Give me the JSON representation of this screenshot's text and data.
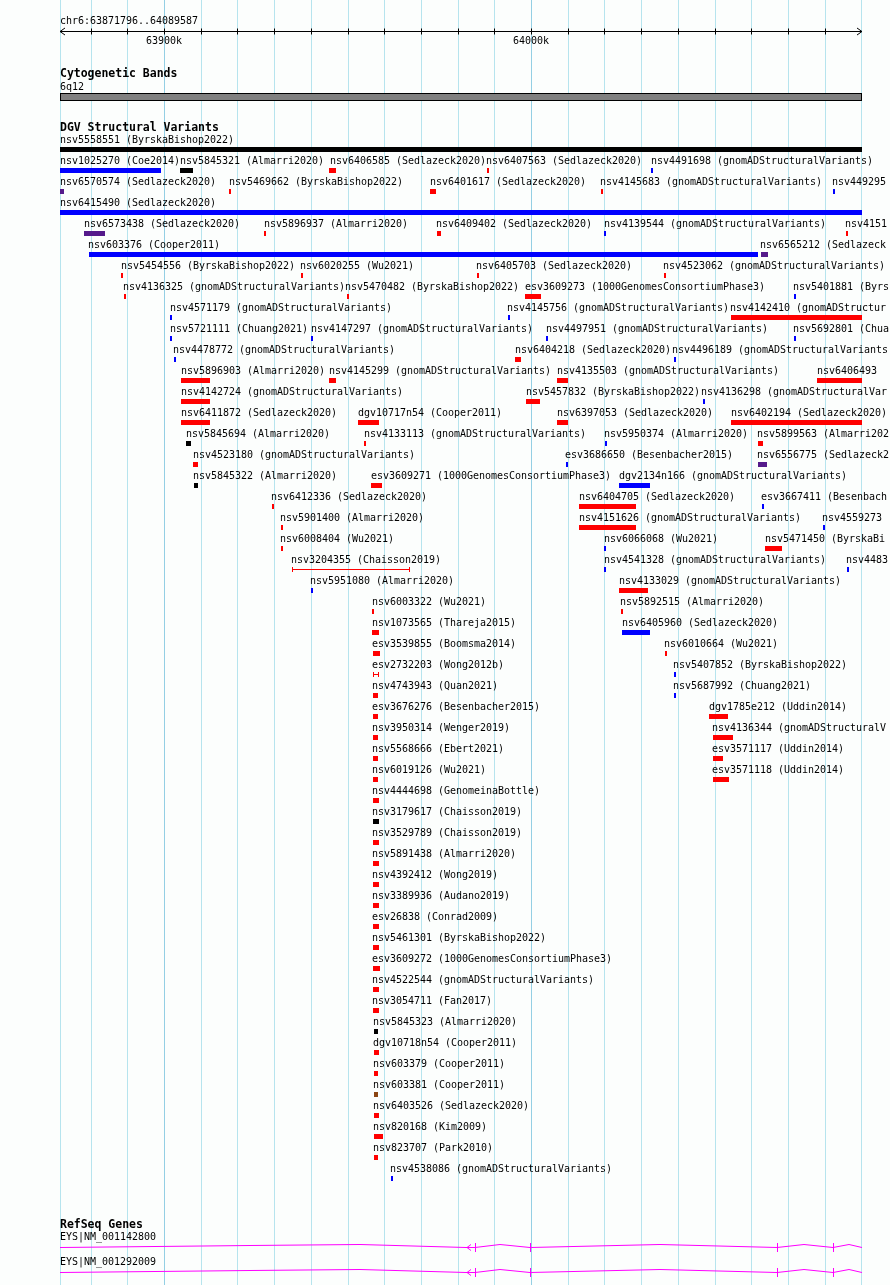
{
  "ruler": {
    "region": "chr6:63871796..64089587",
    "ticks": [
      "63900k",
      "64000k"
    ]
  },
  "cytogenetic_bands": {
    "title": "Cytogenetic Bands",
    "band": "6q12"
  },
  "dgv_structural_variants": {
    "title": "DGV Structural Variants",
    "rows": [
      {
        "variants": [
          {
            "label": "nsv5558551 (ByrskaBishop2022)",
            "color": "#000000",
            "kind": "block"
          }
        ]
      },
      {
        "variants": [
          {
            "label": "nsv1025270 (Coe2014)",
            "color": "#0000ff",
            "kind": "block"
          },
          {
            "label": "nsv5845321 (Almarri2020)",
            "color": "#000000",
            "kind": "block"
          },
          {
            "label": "nsv6406585 (Sedlazeck2020)",
            "color": "#ff0000",
            "kind": "block"
          },
          {
            "label": "nsv6407563 (Sedlazeck2020)",
            "color": "#ff0000",
            "kind": "block"
          },
          {
            "label": "nsv4491698 (gnomADStructuralVariants)",
            "color": "#0000ff",
            "kind": "block"
          }
        ]
      },
      {
        "variants": [
          {
            "label": "nsv6570574 (Sedlazeck2020)",
            "color": "#551a8b",
            "kind": "block"
          },
          {
            "label": "nsv5469662 (ByrskaBishop2022)",
            "color": "#ff0000",
            "kind": "block"
          },
          {
            "label": "nsv6401617 (Sedlazeck2020)",
            "color": "#ff0000",
            "kind": "block"
          },
          {
            "label": "nsv4145683 (gnomADStructuralVariants)",
            "color": "#ff0000",
            "kind": "block"
          },
          {
            "label": "nsv449295",
            "color": "#0000ff",
            "kind": "block"
          }
        ]
      },
      {
        "variants": [
          {
            "label": "nsv6415490 (Sedlazeck2020)",
            "color": "#0000ff",
            "kind": "block"
          }
        ]
      },
      {
        "variants": [
          {
            "label": "nsv6573438 (Sedlazeck2020)",
            "color": "#551a8b",
            "kind": "block"
          },
          {
            "label": "nsv5896937 (Almarri2020)",
            "color": "#ff0000",
            "kind": "block"
          },
          {
            "label": "nsv6409402 (Sedlazeck2020)",
            "color": "#ff0000",
            "kind": "block"
          },
          {
            "label": "nsv4139544 (gnomADStructuralVariants)",
            "color": "#0000ff",
            "kind": "block"
          },
          {
            "label": "nsv4151",
            "color": "#ff0000",
            "kind": "block"
          }
        ]
      },
      {
        "variants": [
          {
            "label": "nsv603376 (Cooper2011)",
            "color": "#0000ff",
            "kind": "block"
          },
          {
            "label": "nsv6565212 (Sedlazeck",
            "color": "#551a8b",
            "kind": "block"
          }
        ]
      },
      {
        "variants": [
          {
            "label": "nsv5454556 (ByrskaBishop2022)",
            "color": "#ff0000",
            "kind": "block"
          },
          {
            "label": "nsv6020255 (Wu2021)",
            "color": "#ff0000",
            "kind": "block"
          },
          {
            "label": "nsv6405703 (Sedlazeck2020)",
            "color": "#ff0000",
            "kind": "block"
          },
          {
            "label": "nsv4523062 (gnomADStructuralVariants)",
            "color": "#ff0000",
            "kind": "block"
          }
        ]
      },
      {
        "variants": [
          {
            "label": "nsv4136325 (gnomADStructuralVariants)",
            "color": "#ff0000",
            "kind": "block"
          },
          {
            "label": "nsv5470482 (ByrskaBishop2022)",
            "color": "#ff0000",
            "kind": "block"
          },
          {
            "label": "esv3609273 (1000GenomesConsortiumPhase3)",
            "color": "#ff0000",
            "kind": "block"
          },
          {
            "label": "nsv5401881 (Byrs",
            "color": "#0000ff",
            "kind": "block"
          }
        ]
      },
      {
        "variants": [
          {
            "label": "nsv4571179 (gnomADStructuralVariants)",
            "color": "#0000ff",
            "kind": "block"
          },
          {
            "label": "nsv4145756 (gnomADStructuralVariants)",
            "color": "#0000ff",
            "kind": "block"
          },
          {
            "label": "nsv4142410 (gnomADStructur",
            "color": "#ff0000",
            "kind": "block"
          }
        ]
      },
      {
        "variants": [
          {
            "label": "nsv5721111 (Chuang2021)",
            "color": "#0000ff",
            "kind": "block"
          },
          {
            "label": "nsv4147297 (gnomADStructuralVariants)",
            "color": "#0000ff",
            "kind": "block"
          },
          {
            "label": "nsv4497951 (gnomADStructuralVariants)",
            "color": "#0000ff",
            "kind": "block"
          },
          {
            "label": "nsv5692801 (Chua",
            "color": "#0000ff",
            "kind": "block"
          }
        ]
      },
      {
        "variants": [
          {
            "label": "nsv4478772 (gnomADStructuralVariants)",
            "color": "#0000ff",
            "kind": "block"
          },
          {
            "label": "nsv6404218 (Sedlazeck2020)",
            "color": "#ff0000",
            "kind": "block"
          },
          {
            "label": "nsv4496189 (gnomADStructuralVariants",
            "color": "#0000ff",
            "kind": "block"
          }
        ]
      },
      {
        "variants": [
          {
            "label": "nsv5896903 (Almarri2020)",
            "color": "#ff0000",
            "kind": "block"
          },
          {
            "label": "nsv4145299 (gnomADStructuralVariants)",
            "color": "#ff0000",
            "kind": "block"
          },
          {
            "label": "nsv4135503 (gnomADStructuralVariants)",
            "color": "#ff0000",
            "kind": "block"
          },
          {
            "label": "nsv6406493",
            "color": "#ff0000",
            "kind": "block"
          }
        ]
      },
      {
        "variants": [
          {
            "label": "nsv4142724 (gnomADStructuralVariants)",
            "color": "#ff0000",
            "kind": "block"
          },
          {
            "label": "nsv5457832 (ByrskaBishop2022)",
            "color": "#ff0000",
            "kind": "block"
          },
          {
            "label": "nsv4136298 (gnomADStructuralVar",
            "color": "#0000ff",
            "kind": "block"
          }
        ]
      },
      {
        "variants": [
          {
            "label": "nsv6411872 (Sedlazeck2020)",
            "color": "#ff0000",
            "kind": "block"
          },
          {
            "label": "dgv10717n54 (Cooper2011)",
            "color": "#ff0000",
            "kind": "block"
          },
          {
            "label": "nsv6397053 (Sedlazeck2020)",
            "color": "#ff0000",
            "kind": "block"
          },
          {
            "label": "nsv6402194 (Sedlazeck2020)",
            "color": "#ff0000",
            "kind": "block"
          }
        ]
      },
      {
        "variants": [
          {
            "label": "nsv5845694 (Almarri2020)",
            "color": "#000000",
            "kind": "block"
          },
          {
            "label": "nsv4133113 (gnomADStructuralVariants)",
            "color": "#ff0000",
            "kind": "block"
          },
          {
            "label": "nsv5950374 (Almarri2020)",
            "color": "#0000ff",
            "kind": "block"
          },
          {
            "label": "nsv5899563 (Almarri202",
            "color": "#ff0000",
            "kind": "block"
          }
        ]
      },
      {
        "variants": [
          {
            "label": "nsv4523180 (gnomADStructuralVariants)",
            "color": "#ff0000",
            "kind": "block"
          },
          {
            "label": "esv3686650 (Besenbacher2015)",
            "color": "#0000ff",
            "kind": "block"
          },
          {
            "label": "nsv6556775 (Sedlazeck2",
            "color": "#551a8b",
            "kind": "block"
          }
        ]
      },
      {
        "variants": [
          {
            "label": "nsv5845322 (Almarri2020)",
            "color": "#000000",
            "kind": "block"
          },
          {
            "label": "esv3609271 (1000GenomesConsortiumPhase3)",
            "color": "#ff0000",
            "kind": "block"
          },
          {
            "label": "dgv2134n166 (gnomADStructuralVariants)",
            "color": "#0000ff",
            "kind": "block"
          }
        ]
      },
      {
        "variants": [
          {
            "label": "nsv6412336 (Sedlazeck2020)",
            "color": "#ff0000",
            "kind": "block"
          },
          {
            "label": "nsv6404705 (Sedlazeck2020)",
            "color": "#ff0000",
            "kind": "block"
          },
          {
            "label": "esv3667411 (Besenbach",
            "color": "#0000ff",
            "kind": "block"
          }
        ]
      },
      {
        "variants": [
          {
            "label": "nsv5901400 (Almarri2020)",
            "color": "#ff0000",
            "kind": "block"
          },
          {
            "label": "nsv4151626 (gnomADStructuralVariants)",
            "color": "#ff0000",
            "kind": "block"
          },
          {
            "label": "nsv4559273",
            "color": "#0000ff",
            "kind": "block"
          }
        ]
      },
      {
        "variants": [
          {
            "label": "nsv6008404 (Wu2021)",
            "color": "#ff0000",
            "kind": "block"
          },
          {
            "label": "nsv6066068 (Wu2021)",
            "color": "#0000ff",
            "kind": "block"
          },
          {
            "label": "nsv5471450 (ByrskaBi",
            "color": "#ff0000",
            "kind": "block"
          }
        ]
      },
      {
        "variants": [
          {
            "label": "nsv3204355 (Chaisson2019)",
            "color": "#ff0000",
            "kind": "bracket"
          },
          {
            "label": "nsv4541328 (gnomADStructuralVariants)",
            "color": "#0000ff",
            "kind": "block"
          },
          {
            "label": "nsv4483",
            "color": "#0000ff",
            "kind": "block"
          }
        ]
      },
      {
        "variants": [
          {
            "label": "nsv5951080 (Almarri2020)",
            "color": "#0000ff",
            "kind": "block"
          },
          {
            "label": "nsv4133029 (gnomADStructuralVariants)",
            "color": "#ff0000",
            "kind": "block"
          }
        ]
      },
      {
        "variants": [
          {
            "label": "nsv6003322 (Wu2021)",
            "color": "#ff0000",
            "kind": "block"
          },
          {
            "label": "nsv5892515 (Almarri2020)",
            "color": "#ff0000",
            "kind": "block"
          }
        ]
      },
      {
        "variants": [
          {
            "label": "nsv1073565 (Thareja2015)",
            "color": "#ff0000",
            "kind": "block"
          },
          {
            "label": "nsv6405960 (Sedlazeck2020)",
            "color": "#0000ff",
            "kind": "block"
          }
        ]
      },
      {
        "variants": [
          {
            "label": "esv3539855 (Boomsma2014)",
            "color": "#ff0000",
            "kind": "block"
          },
          {
            "label": "nsv6010664 (Wu2021)",
            "color": "#ff0000",
            "kind": "block"
          }
        ]
      },
      {
        "variants": [
          {
            "label": "esv2732203 (Wong2012b)",
            "color": "#ff0000",
            "kind": "bracket"
          },
          {
            "label": "nsv5407852 (ByrskaBishop2022)",
            "color": "#0000ff",
            "kind": "block"
          }
        ]
      },
      {
        "variants": [
          {
            "label": "nsv4743943 (Quan2021)",
            "color": "#ff0000",
            "kind": "block"
          },
          {
            "label": "nsv5687992 (Chuang2021)",
            "color": "#0000ff",
            "kind": "block"
          }
        ]
      },
      {
        "variants": [
          {
            "label": "esv3676276 (Besenbacher2015)",
            "color": "#ff0000",
            "kind": "block"
          },
          {
            "label": "dgv1785e212 (Uddin2014)",
            "color": "#ff0000",
            "kind": "block"
          }
        ]
      },
      {
        "variants": [
          {
            "label": "nsv3950314 (Wenger2019)",
            "color": "#ff0000",
            "kind": "block"
          },
          {
            "label": "nsv4136344 (gnomADStructuralV",
            "color": "#ff0000",
            "kind": "block"
          }
        ]
      },
      {
        "variants": [
          {
            "label": "nsv5568666 (Ebert2021)",
            "color": "#ff0000",
            "kind": "block"
          },
          {
            "label": "esv3571117 (Uddin2014)",
            "color": "#ff0000",
            "kind": "block"
          }
        ]
      },
      {
        "variants": [
          {
            "label": "nsv6019126 (Wu2021)",
            "color": "#ff0000",
            "kind": "block"
          },
          {
            "label": "esv3571118 (Uddin2014)",
            "color": "#ff0000",
            "kind": "block"
          }
        ]
      },
      {
        "variants": [
          {
            "label": "nsv4444698 (GenomeinaBottle)",
            "color": "#ff0000",
            "kind": "block"
          }
        ]
      },
      {
        "variants": [
          {
            "label": "nsv3179617 (Chaisson2019)",
            "color": "#000000",
            "kind": "block"
          }
        ]
      },
      {
        "variants": [
          {
            "label": "nsv3529789 (Chaisson2019)",
            "color": "#ff0000",
            "kind": "block"
          }
        ]
      },
      {
        "variants": [
          {
            "label": "nsv5891438 (Almarri2020)",
            "color": "#ff0000",
            "kind": "block"
          }
        ]
      },
      {
        "variants": [
          {
            "label": "nsv4392412 (Wong2019)",
            "color": "#ff0000",
            "kind": "block"
          }
        ]
      },
      {
        "variants": [
          {
            "label": "nsv3389936 (Audano2019)",
            "color": "#ff0000",
            "kind": "block"
          }
        ]
      },
      {
        "variants": [
          {
            "label": "esv26838 (Conrad2009)",
            "color": "#ff0000",
            "kind": "block"
          }
        ]
      },
      {
        "variants": [
          {
            "label": "nsv5461301 (ByrskaBishop2022)",
            "color": "#ff0000",
            "kind": "block"
          }
        ]
      },
      {
        "variants": [
          {
            "label": "esv3609272 (1000GenomesConsortiumPhase3)",
            "color": "#ff0000",
            "kind": "block"
          }
        ]
      },
      {
        "variants": [
          {
            "label": "nsv4522544 (gnomADStructuralVariants)",
            "color": "#ff0000",
            "kind": "block"
          }
        ]
      },
      {
        "variants": [
          {
            "label": "nsv3054711 (Fan2017)",
            "color": "#ff0000",
            "kind": "block"
          }
        ]
      },
      {
        "variants": [
          {
            "label": "nsv5845323 (Almarri2020)",
            "color": "#000000",
            "kind": "block"
          }
        ]
      },
      {
        "variants": [
          {
            "label": "dgv10718n54 (Cooper2011)",
            "color": "#ff0000",
            "kind": "block"
          }
        ]
      },
      {
        "variants": [
          {
            "label": "nsv603379 (Cooper2011)",
            "color": "#ff0000",
            "kind": "block"
          }
        ]
      },
      {
        "variants": [
          {
            "label": "nsv603381 (Cooper2011)",
            "color": "#8b4513",
            "kind": "block"
          }
        ]
      },
      {
        "variants": [
          {
            "label": "nsv6403526 (Sedlazeck2020)",
            "color": "#ff0000",
            "kind": "block"
          }
        ]
      },
      {
        "variants": [
          {
            "label": "nsv820168 (Kim2009)",
            "color": "#ff0000",
            "kind": "block"
          }
        ]
      },
      {
        "variants": [
          {
            "label": "nsv823707 (Park2010)",
            "color": "#ff0000",
            "kind": "block"
          }
        ]
      },
      {
        "variants": [
          {
            "label": "nsv4538086 (gnomADStructuralVariants)",
            "color": "#0000ff",
            "kind": "block"
          }
        ]
      }
    ]
  },
  "refseq_genes": {
    "title": "RefSeq Genes",
    "transcripts": [
      {
        "label": "EYS|NM_001142800"
      },
      {
        "label": "EYS|NM_001292009"
      }
    ]
  }
}
